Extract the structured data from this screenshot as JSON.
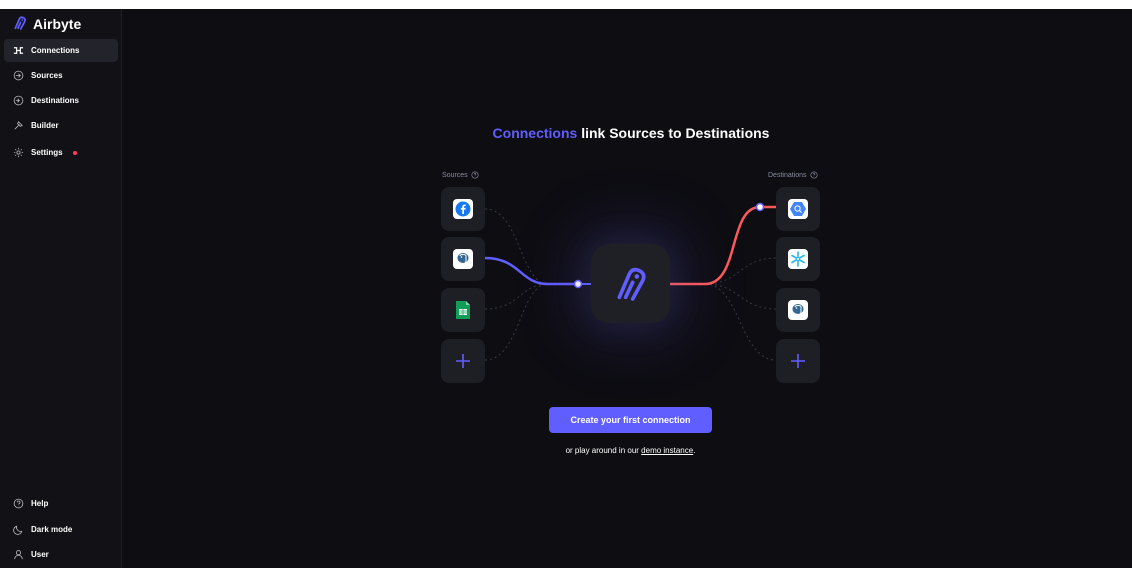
{
  "app": {
    "name": "Airbyte"
  },
  "sidebar": {
    "items": [
      {
        "label": "Connections",
        "icon": "connections-icon",
        "active": true
      },
      {
        "label": "Sources",
        "icon": "sources-icon"
      },
      {
        "label": "Destinations",
        "icon": "destinations-icon"
      },
      {
        "label": "Builder",
        "icon": "builder-icon"
      },
      {
        "label": "Settings",
        "icon": "gear-icon",
        "badge_color": "#ff3b5c"
      }
    ],
    "bottom_items": [
      {
        "label": "Help",
        "icon": "help-icon"
      },
      {
        "label": "Dark mode",
        "icon": "moon-icon"
      },
      {
        "label": "User",
        "icon": "user-icon"
      }
    ]
  },
  "main": {
    "title_accent": "Connections",
    "title_rest": " link Sources to Destinations",
    "sources_label": "Sources",
    "destinations_label": "Destinations",
    "sources": [
      {
        "icon": "facebook-icon"
      },
      {
        "icon": "postgres-icon"
      },
      {
        "icon": "google-sheets-icon"
      },
      {
        "icon": "plus-icon"
      }
    ],
    "destinations": [
      {
        "icon": "bigquery-icon"
      },
      {
        "icon": "snowflake-icon"
      },
      {
        "icon": "postgres-icon"
      },
      {
        "icon": "plus-icon"
      }
    ],
    "cta_label": "Create your first connection",
    "sub_prefix": "or play around in our ",
    "sub_link": "demo instance",
    "sub_suffix": "."
  },
  "colors": {
    "accent": "#615eff",
    "background": "#0d0d12",
    "sidebar": "#111116",
    "destination_line": "#ff5a5a"
  }
}
